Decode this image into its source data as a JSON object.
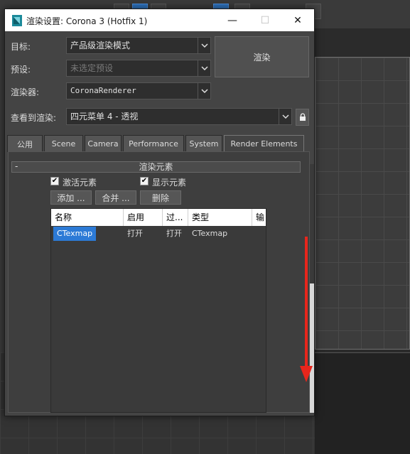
{
  "window": {
    "title": "渲染设置: Corona 3 (Hotfix 1)",
    "minimize_glyph": "—",
    "maximize_glyph": "☐",
    "close_glyph": "✕"
  },
  "form": {
    "target_label": "目标:",
    "target_value": "产品级渲染模式",
    "preset_label": "预设:",
    "preset_value": "未选定预设",
    "renderer_label": "渲染器:",
    "renderer_value": "CoronaRenderer",
    "view_label": "查看到渲染:",
    "view_value": "四元菜单 4 - 透视",
    "render_button": "渲染"
  },
  "tabs": [
    "公用",
    "Scene",
    "Camera",
    "Performance",
    "System",
    "Render Elements"
  ],
  "active_tab": "Render Elements",
  "rollout": {
    "collapse": "-",
    "title": "渲染元素"
  },
  "options": {
    "active_elements": {
      "label": "激活元素",
      "checked": true
    },
    "display_elements": {
      "label": "显示元素",
      "checked": true
    }
  },
  "buttons": {
    "add": "添加 ...",
    "merge": "合并 ...",
    "delete": "删除"
  },
  "list": {
    "columns": [
      "名称",
      "启用",
      "过...",
      "类型",
      "输"
    ],
    "rows": [
      {
        "name": "CTexmap",
        "enabled": "打开",
        "filter": "打开",
        "type": "CTexmap"
      }
    ]
  },
  "icons": {
    "app": "3dsmax-icon",
    "dropdown": "chevron-down-icon",
    "lock": "lock-icon",
    "annotation": "red-down-arrow"
  },
  "colors": {
    "accent": "#2c7ad6",
    "annotation": "#e8261c",
    "panel": "#444444"
  }
}
